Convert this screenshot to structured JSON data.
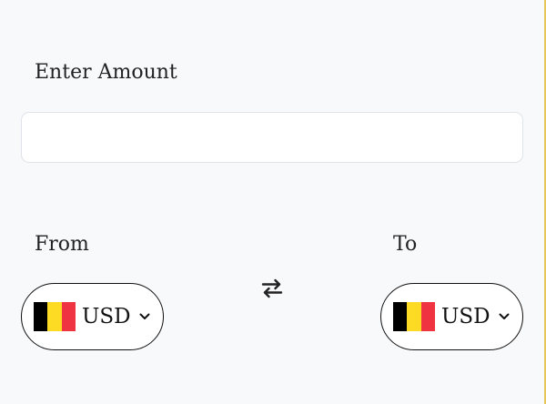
{
  "amount": {
    "label": "Enter Amount",
    "value": "",
    "placeholder": ""
  },
  "from": {
    "label": "From",
    "currency": "USD",
    "flag_icon": "belgium-flag-icon",
    "flag_colors": [
      "#000000",
      "#FDDA24",
      "#EF3340"
    ]
  },
  "to": {
    "label": "To",
    "currency": "USD",
    "flag_icon": "belgium-flag-icon",
    "flag_colors": [
      "#000000",
      "#FDDA24",
      "#EF3340"
    ]
  },
  "swap": {
    "icon": "swap-arrows-icon"
  },
  "colors": {
    "background": "#f8f9fb",
    "accent_border": "#e7c75a"
  }
}
